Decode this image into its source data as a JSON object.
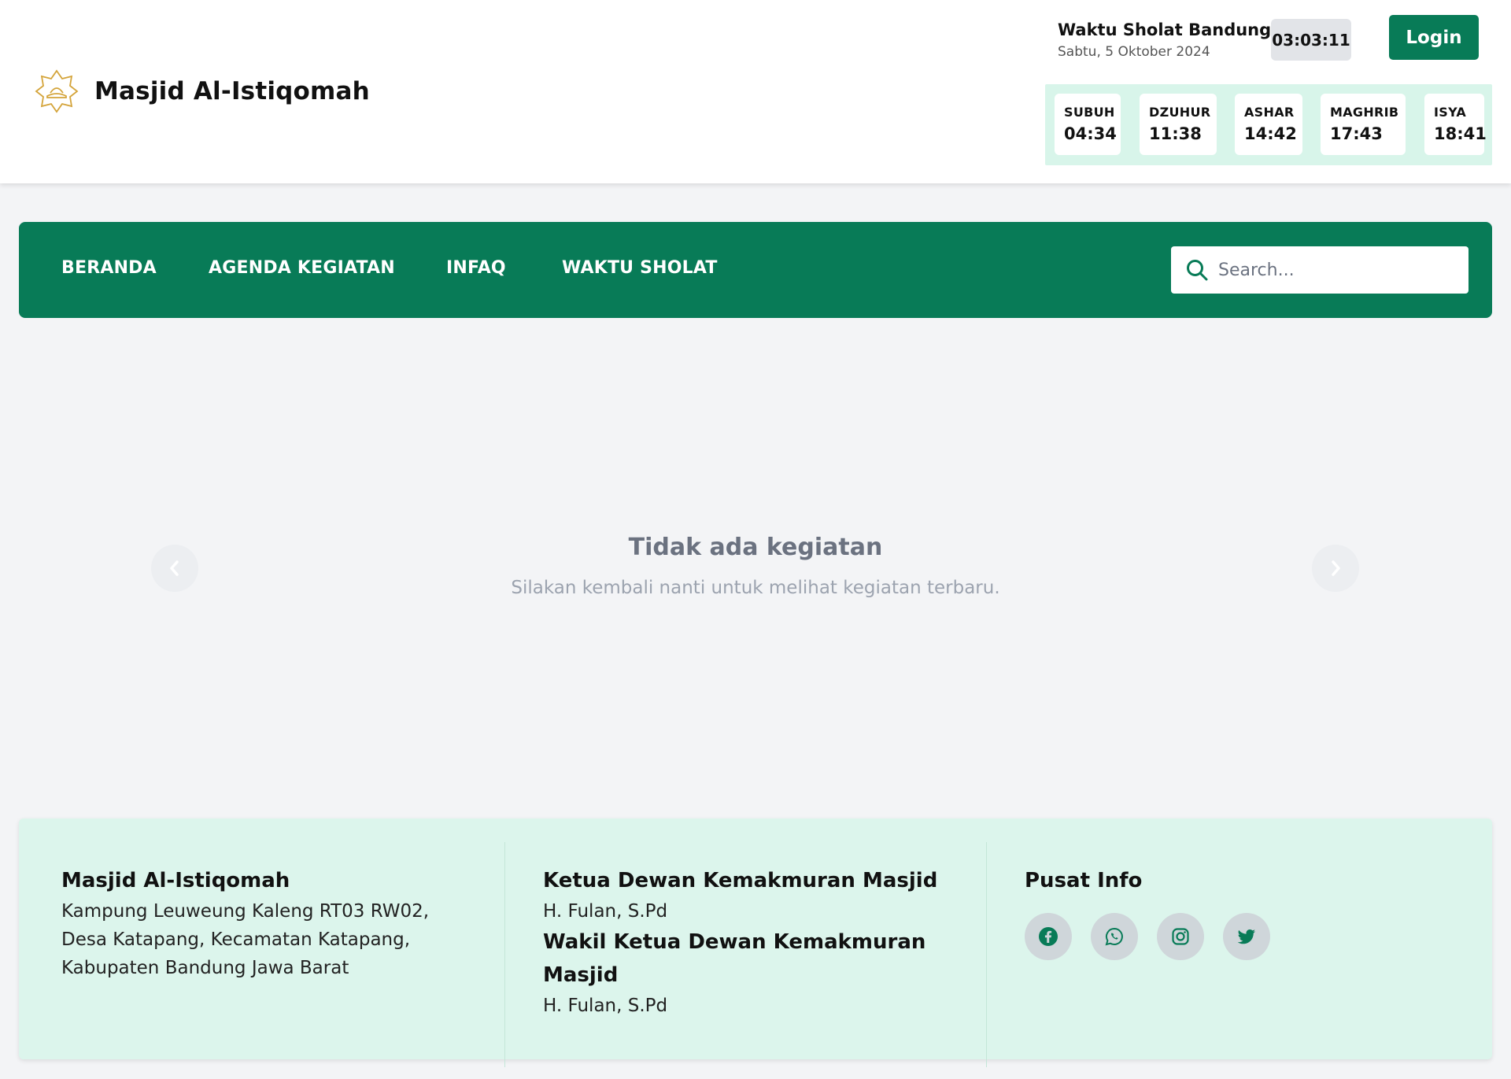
{
  "header": {
    "brand_name": "Masjid Al-Istiqomah",
    "prayer_title": "Waktu Sholat Bandung",
    "prayer_date": "Sabtu, 5 Oktober 2024",
    "clock": "03:03:11",
    "login_label": "Login",
    "prayer_times": [
      {
        "name": "SUBUH",
        "time": "04:34"
      },
      {
        "name": "DZUHUR",
        "time": "11:38"
      },
      {
        "name": "ASHAR",
        "time": "14:42"
      },
      {
        "name": "MAGHRIB",
        "time": "17:43"
      },
      {
        "name": "ISYA",
        "time": "18:41"
      }
    ]
  },
  "nav": {
    "items": [
      "BERANDA",
      "AGENDA KEGIATAN",
      "INFAQ",
      "WAKTU SHOLAT"
    ],
    "search_placeholder": "Search..."
  },
  "main": {
    "empty_title": "Tidak ada kegiatan",
    "empty_subtitle": "Silakan kembali nanti untuk melihat kegiatan terbaru."
  },
  "footer": {
    "col1": {
      "title": "Masjid Al-Istiqomah",
      "address_lines": [
        "Kampung Leuweung Kaleng RT03 RW02,",
        "Desa Katapang, Kecamatan Katapang,",
        "Kabupaten Bandung Jawa Barat"
      ]
    },
    "col2": {
      "chair_title": "Ketua Dewan Kemakmuran Masjid",
      "chair_name": "H. Fulan, S.Pd",
      "vice_title_line1": "Wakil Ketua Dewan Kemakmuran",
      "vice_title_line2": "Masjid",
      "vice_name": "H. Fulan, S.Pd"
    },
    "col3": {
      "title": "Pusat Info",
      "socials": [
        "facebook-icon",
        "whatsapp-icon",
        "instagram-icon",
        "twitter-icon"
      ]
    }
  },
  "colors": {
    "primary": "#087b57",
    "mint": "#dcf5ec",
    "gold": "#d4a43a"
  }
}
